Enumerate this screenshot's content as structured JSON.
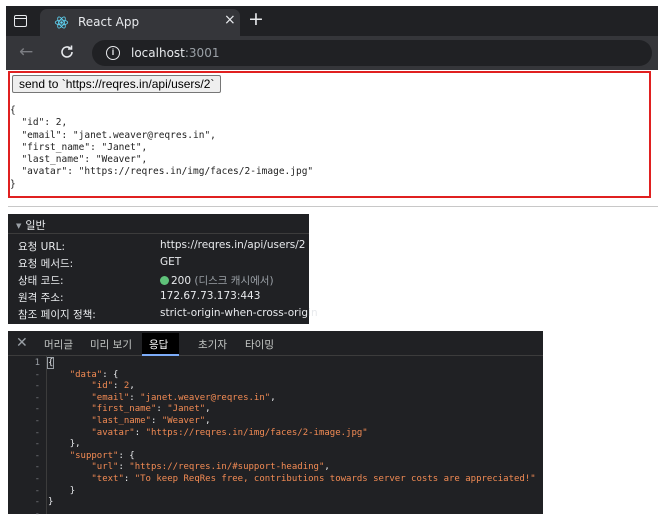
{
  "browser": {
    "tab_title": "React App",
    "tab_close": "×",
    "new_tab": "+",
    "url_host": "localhost",
    "url_port": ":3001"
  },
  "page": {
    "send_button_label": "send to `https://reqres.in/api/users/2`",
    "json_output": "{\n  \"id\": 2,\n  \"email\": \"janet.weaver@reqres.in\",\n  \"first_name\": \"Janet\",\n  \"last_name\": \"Weaver\",\n  \"avatar\": \"https://reqres.in/img/faces/2-image.jpg\"\n}"
  },
  "general": {
    "title": "일반",
    "rows": [
      {
        "key": "요청 URL:",
        "value": "https://reqres.in/api/users/2"
      },
      {
        "key": "요청 메서드:",
        "value": "GET"
      },
      {
        "key": "상태 코드:",
        "value": "200",
        "value_note": "(디스크 캐시에서)"
      },
      {
        "key": "원격 주소:",
        "value": "172.67.73.173:443"
      },
      {
        "key": "참조 페이지 정책:",
        "value": "strict-origin-when-cross-origin"
      }
    ],
    "status_color": "#5fc27a"
  },
  "response": {
    "tabs": [
      "머리글",
      "미리 보기",
      "응답",
      "초기자",
      "타이밍"
    ],
    "active_tab": "응답",
    "line_numbers": [
      "1",
      "-",
      "-",
      "-",
      "-",
      "-",
      "-",
      "-",
      "-",
      "-",
      "-",
      "-",
      "-",
      "-"
    ],
    "code": {
      "data_key": "\"data\"",
      "id_key": "\"id\"",
      "id_val": "2",
      "email_key": "\"email\"",
      "email_val": "\"janet.weaver@reqres.in\"",
      "first_key": "\"first_name\"",
      "first_val": "\"Janet\"",
      "last_key": "\"last_name\"",
      "last_val": "\"Weaver\"",
      "avatar_key": "\"avatar\"",
      "avatar_val": "\"https://reqres.in/img/faces/2-image.jpg\"",
      "support_key": "\"support\"",
      "url_key": "\"url\"",
      "url_val": "\"https://reqres.in/#support-heading\"",
      "text_key": "\"text\"",
      "text_val": "\"To keep ReqRes free, contributions towards server costs are appreciated!\""
    }
  },
  "colors": {
    "highlight_border": "#e02020",
    "devtools_bg": "#202124",
    "json_string": "#f28b54"
  }
}
